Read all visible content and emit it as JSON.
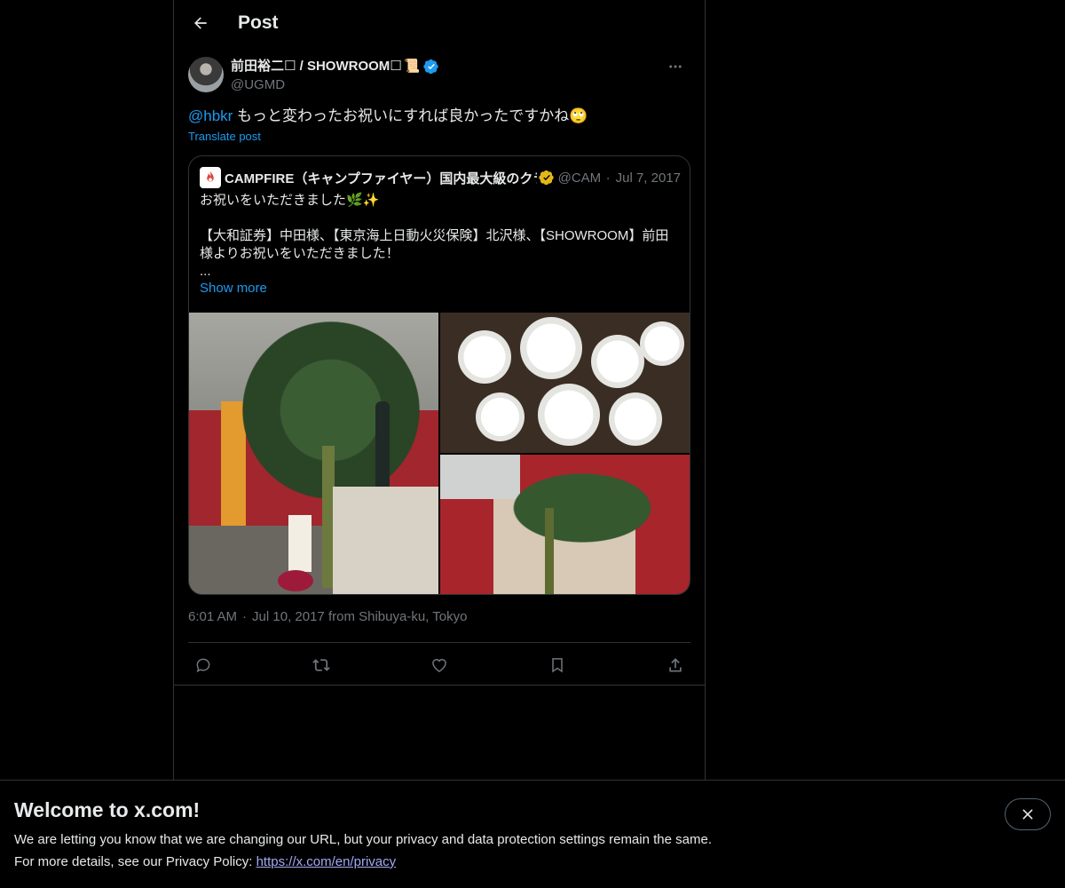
{
  "header": {
    "title": "Post"
  },
  "author": {
    "display_name": "前田裕二☐ / SHOWROOM☐",
    "scroll_emoji": "📜",
    "handle": "@UGMD"
  },
  "post": {
    "mention": "@hbkr",
    "text": " もっと変わったお祝いにすれば良かったですかね🙄",
    "translate_label": "Translate post"
  },
  "quote": {
    "name": "CAMPFIRE（キャンプファイヤー）国内最大級のクラウドファンディング",
    "handle": "@CAMPFIREjp",
    "date": "Jul 7, 2017",
    "lines": [
      "お祝いをいただきました🌿✨",
      "",
      "【大和証券】中田様、【東京海上日動火災保険】北沢様、【SHOWROOM】前田様よりお祝いをいただきました！",
      "..."
    ],
    "show_more": "Show more"
  },
  "meta": {
    "time": "6:01 AM",
    "date_location": "Jul 10, 2017 from Shibuya-ku, Tokyo"
  },
  "banner": {
    "title": "Welcome to x.com!",
    "line1": "We are letting you know that we are changing our URL, but your privacy and data protection settings remain the same.",
    "line2_prefix": "For more details, see our Privacy Policy: ",
    "link": "https://x.com/en/privacy"
  },
  "colors": {
    "accent": "#1d9bf0",
    "verified_gold": "#e2b719",
    "link_purple": "#a3a9f5"
  },
  "icons": {
    "back": "arrow-left-icon",
    "more": "more-horizontal-icon",
    "reply": "reply-icon",
    "repost": "repost-icon",
    "like": "heart-icon",
    "bookmark": "bookmark-icon",
    "share": "share-icon",
    "close": "close-icon"
  }
}
